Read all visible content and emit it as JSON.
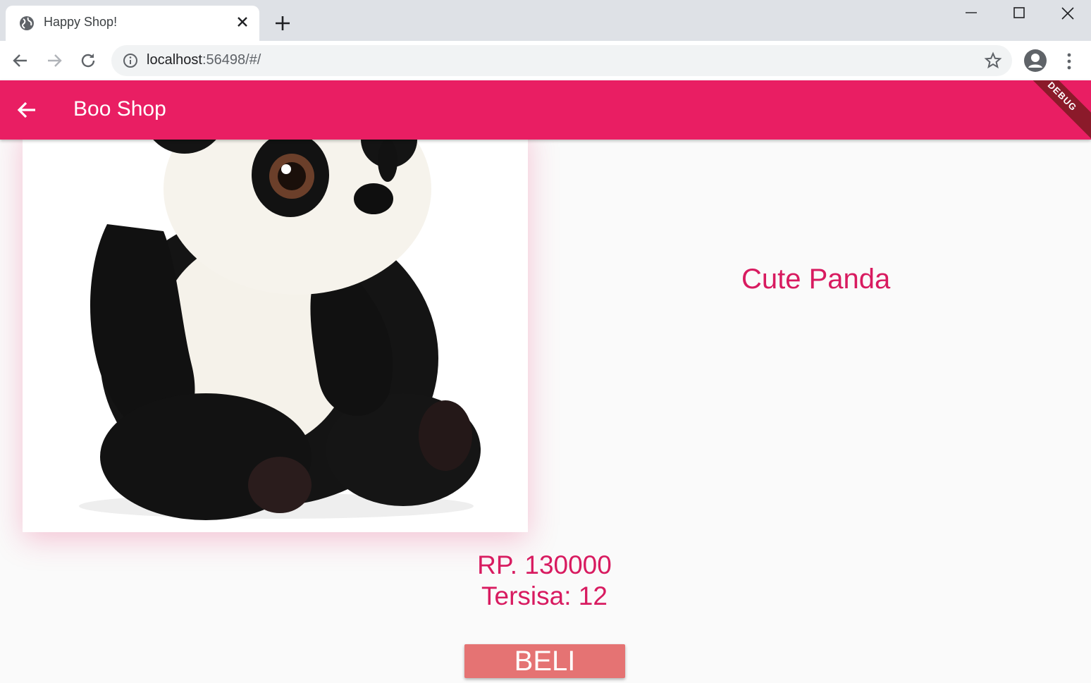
{
  "browser": {
    "tab_title": "Happy Shop!",
    "url_host": "localhost",
    "url_rest": ":56498/#/"
  },
  "icons": {
    "favicon": "globe-icon",
    "tab_close": "close-icon",
    "new_tab": "plus-icon",
    "back": "arrow-left-icon",
    "forward": "arrow-right-icon",
    "reload": "reload-icon",
    "site_info": "info-icon",
    "bookmark": "star-icon",
    "profile": "account-icon",
    "menu": "more-vert-icon"
  },
  "app": {
    "title": "Boo Shop",
    "debug_label": "DEBUG",
    "accent_color": "#e91e63"
  },
  "product": {
    "name": "Cute Panda",
    "price": "RP. 130000",
    "stock": "Tersisa: 12",
    "buy_label": "BELI"
  }
}
